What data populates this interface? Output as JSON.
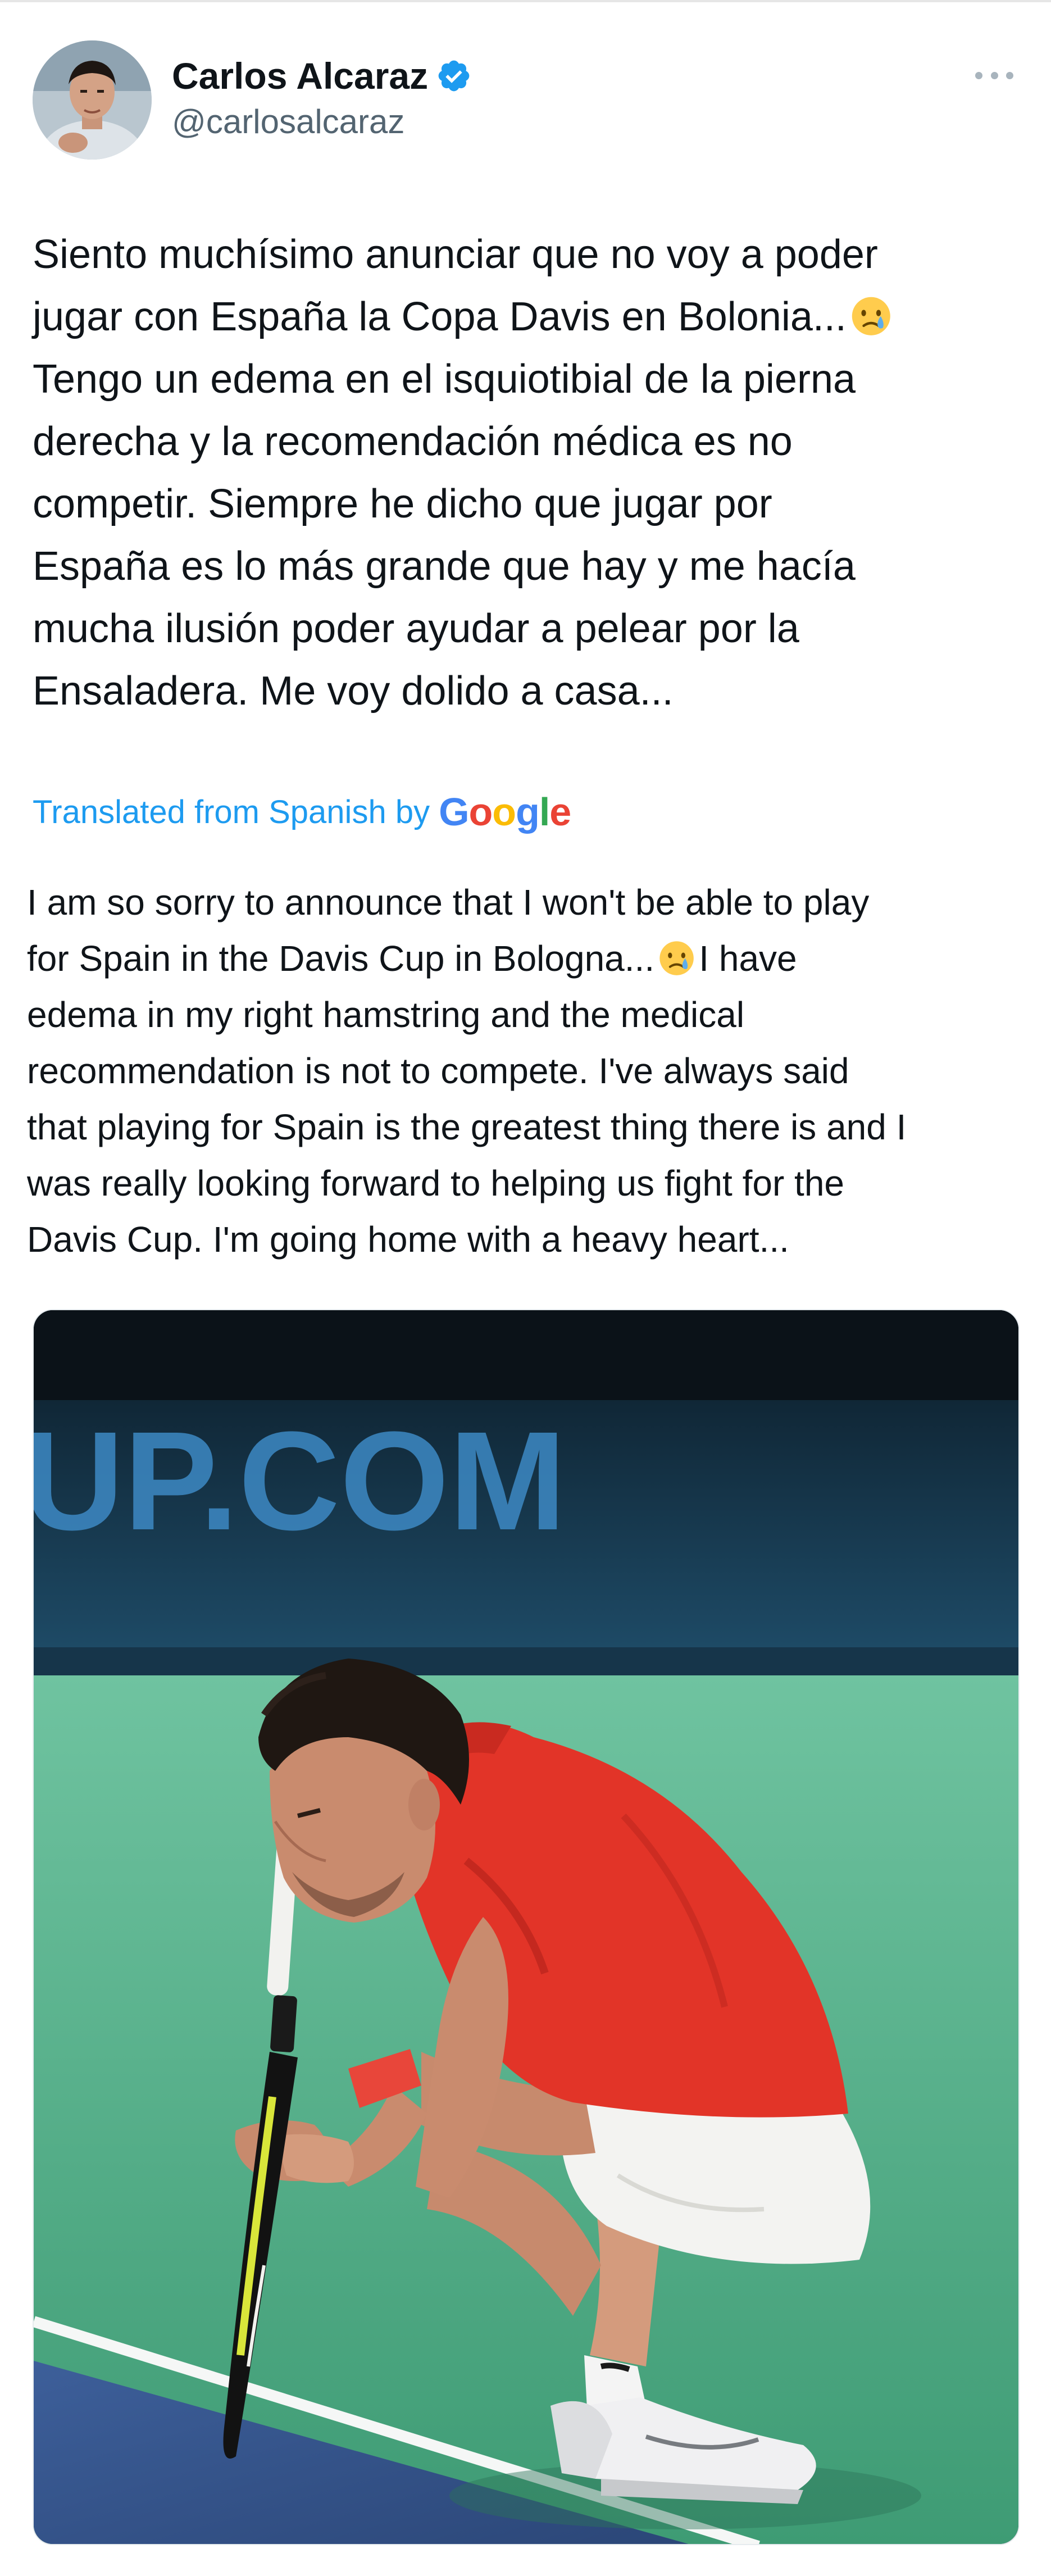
{
  "author": {
    "display_name": "Carlos Alcaraz",
    "handle": "@carlosalcaraz",
    "verified": true,
    "avatar_icon": "profile-photo"
  },
  "more_icon": "more-horizontal-icon",
  "tweet": {
    "lines": [
      "Siento muchísimo anunciar que no voy a poder",
      "jugar con España la Copa Davis en Bolonia...",
      "Tengo un edema en el isquiotibial de la pierna",
      "derecha y la recomendación médica es no",
      "competir. Siempre he dicho que jugar por",
      "España es lo más grande que hay y me hacía",
      "mucha ilusión poder ayudar a pelear por la",
      "Ensaladera. Me voy dolido a casa..."
    ],
    "emoji": "crying-face"
  },
  "translation": {
    "label": "Translated from Spanish by",
    "provider": "Google",
    "lines": [
      "I am so sorry to announce that I won't be able to play",
      "for Spain in the Davis Cup in Bologna...",
      "I have",
      "edema in my right hamstring and the medical",
      "recommendation is not to compete. I've always said",
      "that playing for Spain is the greatest thing there is and I",
      "was really looking forward to helping us fight for the",
      "Davis Cup. I'm going home with a heavy heart..."
    ]
  },
  "media": {
    "background_text": "UP.COM",
    "description_icon": "photo"
  },
  "colors": {
    "link_blue": "#1d9bf0",
    "verified_blue": "#1d9bf0",
    "text_primary": "#0f1419",
    "text_secondary": "#536471",
    "court_green": "#3e9b74",
    "shirt_red": "#e23428"
  }
}
